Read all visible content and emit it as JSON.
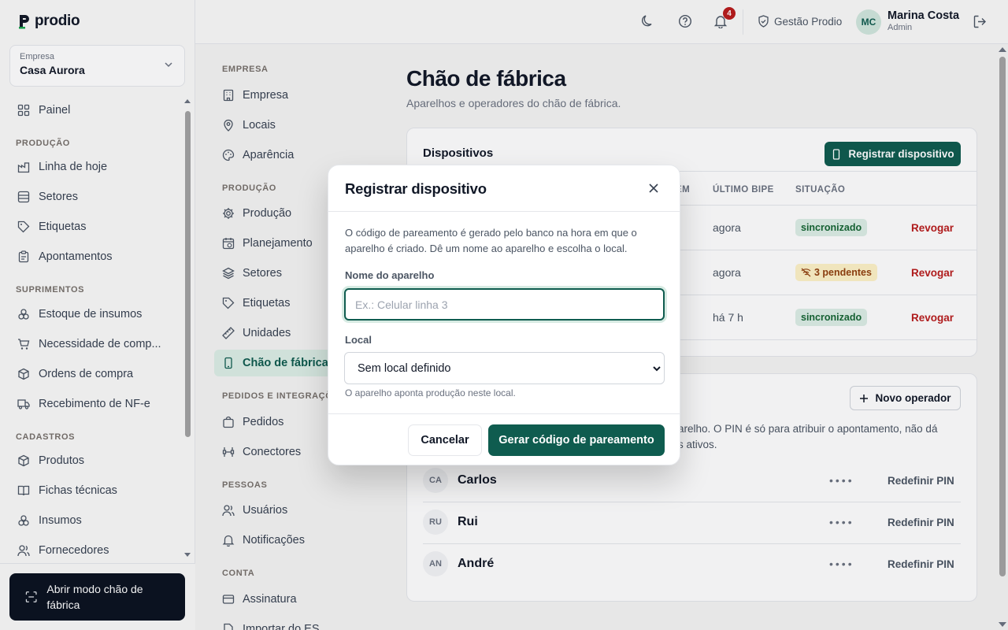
{
  "app": {
    "name": "prodio"
  },
  "company_select": {
    "label": "Empresa",
    "value": "Casa Aurora"
  },
  "sidebar": {
    "painel": "Painel",
    "sections": {
      "producao": "PRODUÇÃO",
      "suprimentos": "SUPRIMENTOS",
      "cadastros": "CADASTROS"
    },
    "items": {
      "linha": "Linha de hoje",
      "setores": "Setores",
      "etiquetas": "Etiquetas",
      "apontamentos": "Apontamentos",
      "estoque": "Estoque de insumos",
      "necessidade": "Necessidade de comp...",
      "ordens": "Ordens de compra",
      "recebimento": "Recebimento de NF-e",
      "produtos": "Produtos",
      "fichas": "Fichas técnicas",
      "insumos": "Insumos",
      "fornecedores": "Fornecedores"
    },
    "floor_button": "Abrir modo chão de fábrica"
  },
  "header": {
    "notifications_count": "4",
    "tenant": "Gestão Prodio",
    "user_initials": "MC",
    "user_name": "Marina Costa",
    "user_role": "Admin"
  },
  "settings_nav": {
    "sections": {
      "empresa": "EMPRESA",
      "producao": "PRODUÇÃO",
      "pedidos": "PEDIDOS E INTEGRAÇÕES",
      "pessoas": "PESSOAS",
      "conta": "CONTA"
    },
    "items": {
      "empresa": "Empresa",
      "locais": "Locais",
      "aparencia": "Aparência",
      "producao": "Produção",
      "planejamento": "Planejamento",
      "setores": "Setores",
      "etiquetas": "Etiquetas",
      "unidades": "Unidades",
      "chao": "Chão de fábrica",
      "pedidos": "Pedidos",
      "conectores": "Conectores",
      "usuarios": "Usuários",
      "notificacoes": "Notificações",
      "assinatura": "Assinatura",
      "importar": "Importar do ES..."
    }
  },
  "page": {
    "title": "Chão de fábrica",
    "subtitle": "Aparelhos e operadores do chão de fábrica."
  },
  "devices": {
    "title": "Dispositivos",
    "register_button": "Registrar dispositivo",
    "columns": {
      "partial": "EM",
      "last_beep": "ÚLTIMO BIPE",
      "status": "SITUAÇÃO"
    },
    "rows": [
      {
        "last_beep": "agora",
        "status": "sincronizado",
        "status_kind": "ok",
        "action": "Revogar"
      },
      {
        "last_beep": "agora",
        "status": "3 pendentes",
        "status_kind": "warn",
        "action": "Revogar"
      },
      {
        "last_beep": "há 7 h",
        "status": "sincronizado",
        "status_kind": "ok",
        "action": "Revogar"
      }
    ]
  },
  "operators": {
    "new_button": "Novo operador",
    "description": "arelho. O PIN é só para atribuir o apontamento, não dá s ativos.",
    "description_line1": "arelho. O PIN é só para atribuir o apontamento, não dá",
    "description_line2": "s ativos.",
    "rows": [
      {
        "initials": "CA",
        "name": "Carlos",
        "pin": "••••",
        "action": "Redefinir PIN"
      },
      {
        "initials": "RU",
        "name": "Rui",
        "pin": "••••",
        "action": "Redefinir PIN"
      },
      {
        "initials": "AN",
        "name": "André",
        "pin": "••••",
        "action": "Redefinir PIN"
      }
    ]
  },
  "modal": {
    "title": "Registrar dispositivo",
    "description": "O código de pareamento é gerado pelo banco na hora em que o aparelho é criado. Dê um nome ao aparelho e escolha o local.",
    "name_label": "Nome do aparelho",
    "name_value": "",
    "name_placeholder": "Ex.: Celular linha 3",
    "local_label": "Local",
    "local_value": "Sem local definido",
    "local_hint": "O aparelho aponta produção neste local.",
    "cancel": "Cancelar",
    "submit": "Gerar código de pareamento"
  },
  "colors": {
    "brand": "#0f5c4f",
    "danger": "#b91c1c",
    "ok_bg": "#dcefe6",
    "warn_bg": "#fef3c7"
  }
}
